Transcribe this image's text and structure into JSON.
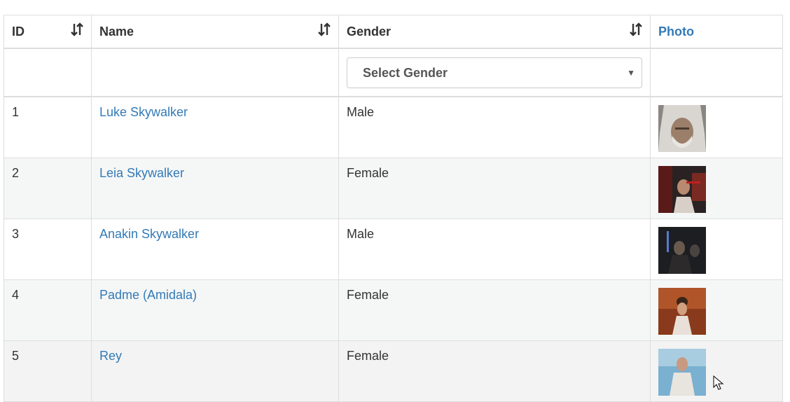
{
  "table": {
    "headers": {
      "id": "ID",
      "name": "Name",
      "gender": "Gender",
      "photo": "Photo"
    },
    "sort_icon": "sort-arrows-icon",
    "filter": {
      "gender_select_value": "Select Gender"
    },
    "rows": [
      {
        "id": "1",
        "name": "Luke Skywalker",
        "gender": "Male",
        "photo": "luke-photo"
      },
      {
        "id": "2",
        "name": "Leia Skywalker",
        "gender": "Female",
        "photo": "leia-photo"
      },
      {
        "id": "3",
        "name": "Anakin Skywalker",
        "gender": "Male",
        "photo": "anakin-photo"
      },
      {
        "id": "4",
        "name": "Padme (Amidala)",
        "gender": "Female",
        "photo": "padme-photo"
      },
      {
        "id": "5",
        "name": "Rey",
        "gender": "Female",
        "photo": "rey-photo"
      }
    ]
  },
  "colors": {
    "link": "#337ab7",
    "border": "#dddddd",
    "stripe": "#f5f7f7"
  }
}
